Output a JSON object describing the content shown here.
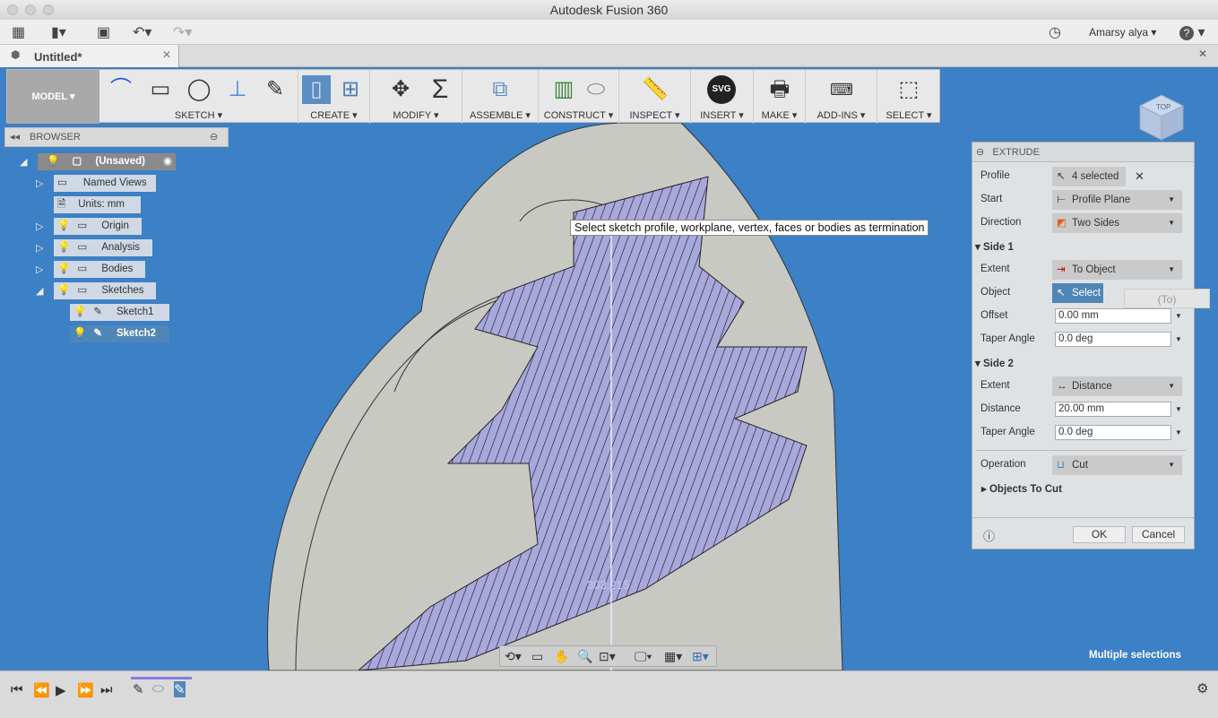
{
  "window": {
    "title": "Autodesk Fusion 360",
    "user": "Amarsy alya",
    "help": "?"
  },
  "document_tab": {
    "title": "Untitled*"
  },
  "toolbar": {
    "workspace": "MODEL",
    "groups": [
      {
        "label": "SKETCH"
      },
      {
        "label": "CREATE"
      },
      {
        "label": "MODIFY"
      },
      {
        "label": "ASSEMBLE"
      },
      {
        "label": "CONSTRUCT"
      },
      {
        "label": "INSPECT"
      },
      {
        "label": "INSERT"
      },
      {
        "label": "MAKE"
      },
      {
        "label": "ADD-INS"
      },
      {
        "label": "SELECT"
      }
    ],
    "insert_svg_text": "SVG"
  },
  "browser": {
    "title": "BROWSER",
    "root": "(Unsaved)",
    "items": [
      {
        "label": "Named Views"
      },
      {
        "label": "Units: mm"
      },
      {
        "label": "Origin"
      },
      {
        "label": "Analysis"
      },
      {
        "label": "Bodies"
      },
      {
        "label": "Sketches"
      },
      {
        "label": "Sketch1"
      },
      {
        "label": "Sketch2"
      }
    ]
  },
  "viewport": {
    "tooltip": "Select sketch profile, workplane, vertex, faces or bodies as termination",
    "readout": "303.215",
    "status": "Multiple selections",
    "viewcube_face": "TOP",
    "ghost_field": "(To)"
  },
  "extrude": {
    "title": "EXTRUDE",
    "profile": {
      "label": "Profile",
      "value": "4 selected"
    },
    "start": {
      "label": "Start",
      "value": "Profile Plane"
    },
    "direction": {
      "label": "Direction",
      "value": "Two Sides"
    },
    "side1": {
      "title": "Side 1",
      "extent_label": "Extent",
      "extent": "To Object",
      "object_label": "Object",
      "object_button": "Select",
      "offset_label": "Offset",
      "offset": "0.00 mm",
      "taper_label": "Taper Angle",
      "taper": "0.0 deg"
    },
    "side2": {
      "title": "Side 2",
      "extent_label": "Extent",
      "extent": "Distance",
      "distance_label": "Distance",
      "distance": "20.00 mm",
      "taper_label": "Taper Angle",
      "taper": "0.0 deg"
    },
    "operation": {
      "label": "Operation",
      "value": "Cut"
    },
    "objects_to_cut": "Objects To Cut",
    "ok": "OK",
    "cancel": "Cancel"
  },
  "colors": {
    "viewport": "#3c80c6",
    "hatch": "#a8a8dc",
    "accent": "#4f86b8"
  }
}
